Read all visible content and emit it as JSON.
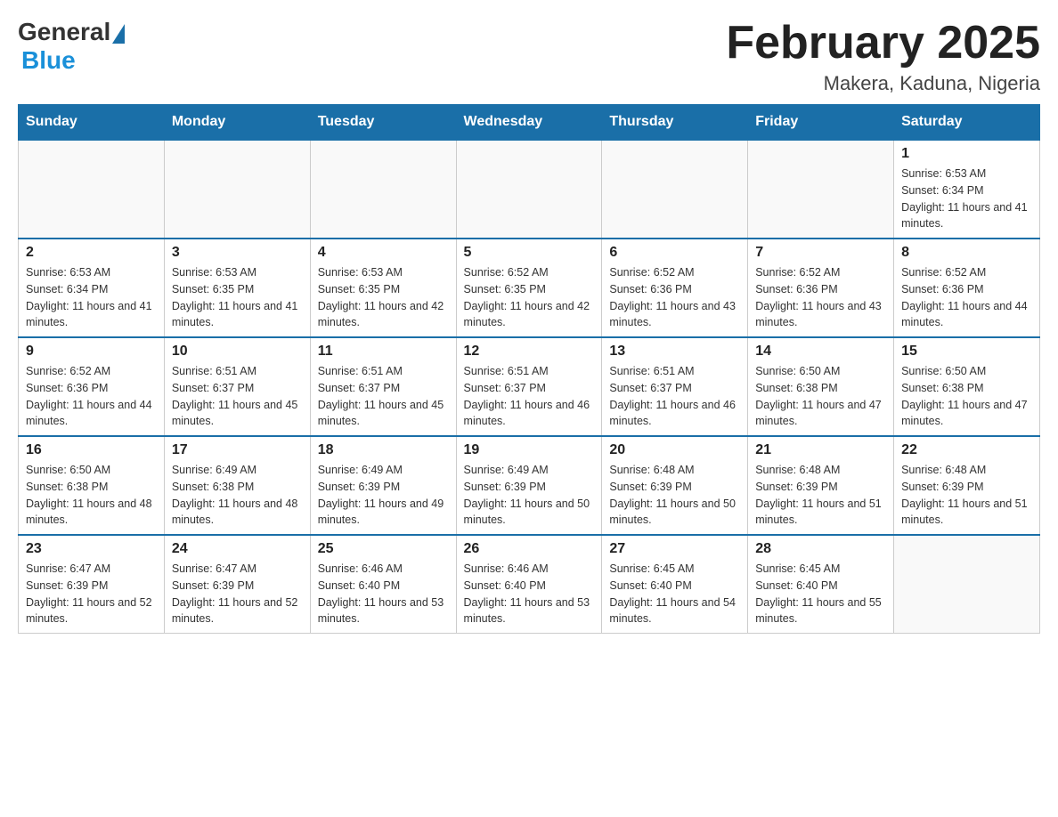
{
  "logo": {
    "general": "General",
    "blue": "Blue"
  },
  "title": "February 2025",
  "location": "Makera, Kaduna, Nigeria",
  "days_of_week": [
    "Sunday",
    "Monday",
    "Tuesday",
    "Wednesday",
    "Thursday",
    "Friday",
    "Saturday"
  ],
  "weeks": [
    [
      {
        "day": "",
        "info": ""
      },
      {
        "day": "",
        "info": ""
      },
      {
        "day": "",
        "info": ""
      },
      {
        "day": "",
        "info": ""
      },
      {
        "day": "",
        "info": ""
      },
      {
        "day": "",
        "info": ""
      },
      {
        "day": "1",
        "info": "Sunrise: 6:53 AM\nSunset: 6:34 PM\nDaylight: 11 hours and 41 minutes."
      }
    ],
    [
      {
        "day": "2",
        "info": "Sunrise: 6:53 AM\nSunset: 6:34 PM\nDaylight: 11 hours and 41 minutes."
      },
      {
        "day": "3",
        "info": "Sunrise: 6:53 AM\nSunset: 6:35 PM\nDaylight: 11 hours and 41 minutes."
      },
      {
        "day": "4",
        "info": "Sunrise: 6:53 AM\nSunset: 6:35 PM\nDaylight: 11 hours and 42 minutes."
      },
      {
        "day": "5",
        "info": "Sunrise: 6:52 AM\nSunset: 6:35 PM\nDaylight: 11 hours and 42 minutes."
      },
      {
        "day": "6",
        "info": "Sunrise: 6:52 AM\nSunset: 6:36 PM\nDaylight: 11 hours and 43 minutes."
      },
      {
        "day": "7",
        "info": "Sunrise: 6:52 AM\nSunset: 6:36 PM\nDaylight: 11 hours and 43 minutes."
      },
      {
        "day": "8",
        "info": "Sunrise: 6:52 AM\nSunset: 6:36 PM\nDaylight: 11 hours and 44 minutes."
      }
    ],
    [
      {
        "day": "9",
        "info": "Sunrise: 6:52 AM\nSunset: 6:36 PM\nDaylight: 11 hours and 44 minutes."
      },
      {
        "day": "10",
        "info": "Sunrise: 6:51 AM\nSunset: 6:37 PM\nDaylight: 11 hours and 45 minutes."
      },
      {
        "day": "11",
        "info": "Sunrise: 6:51 AM\nSunset: 6:37 PM\nDaylight: 11 hours and 45 minutes."
      },
      {
        "day": "12",
        "info": "Sunrise: 6:51 AM\nSunset: 6:37 PM\nDaylight: 11 hours and 46 minutes."
      },
      {
        "day": "13",
        "info": "Sunrise: 6:51 AM\nSunset: 6:37 PM\nDaylight: 11 hours and 46 minutes."
      },
      {
        "day": "14",
        "info": "Sunrise: 6:50 AM\nSunset: 6:38 PM\nDaylight: 11 hours and 47 minutes."
      },
      {
        "day": "15",
        "info": "Sunrise: 6:50 AM\nSunset: 6:38 PM\nDaylight: 11 hours and 47 minutes."
      }
    ],
    [
      {
        "day": "16",
        "info": "Sunrise: 6:50 AM\nSunset: 6:38 PM\nDaylight: 11 hours and 48 minutes."
      },
      {
        "day": "17",
        "info": "Sunrise: 6:49 AM\nSunset: 6:38 PM\nDaylight: 11 hours and 48 minutes."
      },
      {
        "day": "18",
        "info": "Sunrise: 6:49 AM\nSunset: 6:39 PM\nDaylight: 11 hours and 49 minutes."
      },
      {
        "day": "19",
        "info": "Sunrise: 6:49 AM\nSunset: 6:39 PM\nDaylight: 11 hours and 50 minutes."
      },
      {
        "day": "20",
        "info": "Sunrise: 6:48 AM\nSunset: 6:39 PM\nDaylight: 11 hours and 50 minutes."
      },
      {
        "day": "21",
        "info": "Sunrise: 6:48 AM\nSunset: 6:39 PM\nDaylight: 11 hours and 51 minutes."
      },
      {
        "day": "22",
        "info": "Sunrise: 6:48 AM\nSunset: 6:39 PM\nDaylight: 11 hours and 51 minutes."
      }
    ],
    [
      {
        "day": "23",
        "info": "Sunrise: 6:47 AM\nSunset: 6:39 PM\nDaylight: 11 hours and 52 minutes."
      },
      {
        "day": "24",
        "info": "Sunrise: 6:47 AM\nSunset: 6:39 PM\nDaylight: 11 hours and 52 minutes."
      },
      {
        "day": "25",
        "info": "Sunrise: 6:46 AM\nSunset: 6:40 PM\nDaylight: 11 hours and 53 minutes."
      },
      {
        "day": "26",
        "info": "Sunrise: 6:46 AM\nSunset: 6:40 PM\nDaylight: 11 hours and 53 minutes."
      },
      {
        "day": "27",
        "info": "Sunrise: 6:45 AM\nSunset: 6:40 PM\nDaylight: 11 hours and 54 minutes."
      },
      {
        "day": "28",
        "info": "Sunrise: 6:45 AM\nSunset: 6:40 PM\nDaylight: 11 hours and 55 minutes."
      },
      {
        "day": "",
        "info": ""
      }
    ]
  ]
}
